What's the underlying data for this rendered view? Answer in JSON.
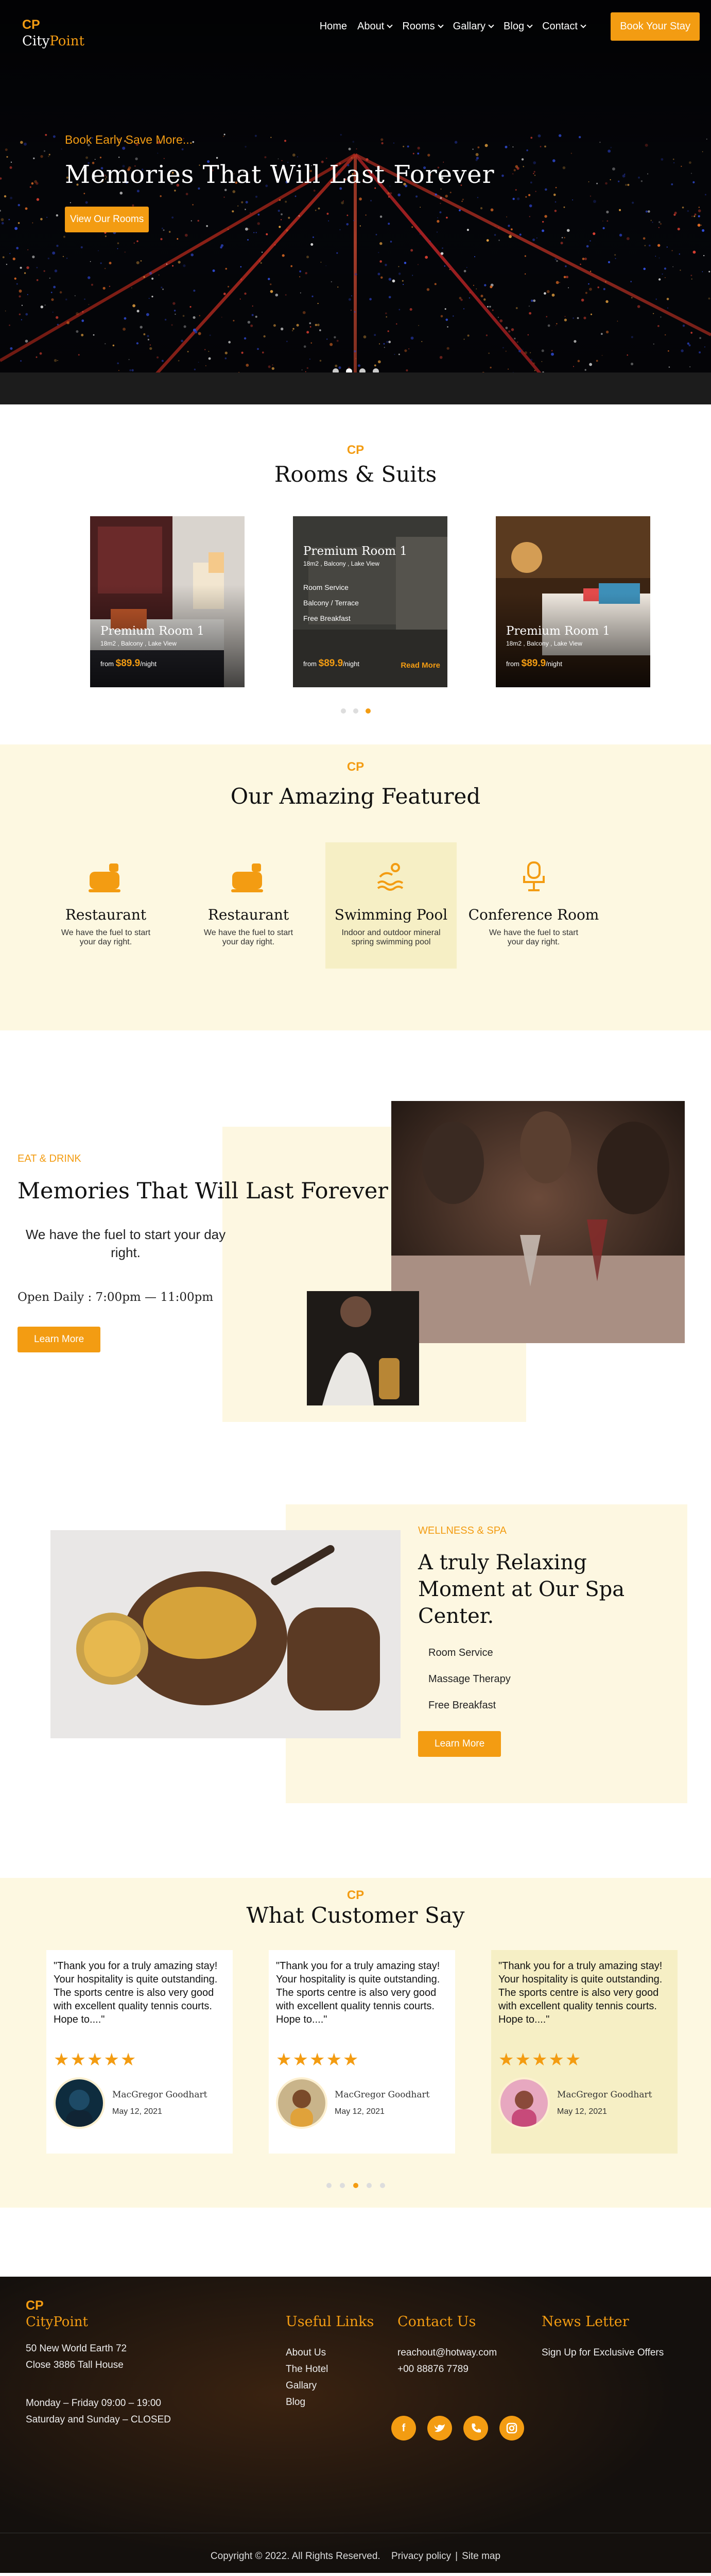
{
  "header": {
    "logo_cp": "CP",
    "logo_city": "City",
    "logo_point": "Point",
    "nav": [
      {
        "label": "Home",
        "dropdown": false
      },
      {
        "label": "About",
        "dropdown": true
      },
      {
        "label": "Rooms",
        "dropdown": true
      },
      {
        "label": "Gallary",
        "dropdown": true
      },
      {
        "label": "Blog",
        "dropdown": true
      },
      {
        "label": "Contact",
        "dropdown": true
      }
    ],
    "book_label": "Book Your Stay"
  },
  "hero": {
    "subtitle": "Book Early Save More...",
    "title": "Memories That Will Last Forever",
    "cta": "View Our Rooms",
    "slides": 4,
    "active_slide": 2
  },
  "rooms": {
    "cp": "CP",
    "title": "Rooms & Suits",
    "cards": [
      {
        "name": "Premium Room 1",
        "meta": "18m2 , Balcony , Lake View",
        "price_prefix": "from",
        "price": "$89.9",
        "price_suffix": "/night"
      },
      {
        "name": "Premium Room 1",
        "meta": "18m2 , Balcony , Lake View",
        "features": [
          "Room Service",
          "Balcony / Terrace",
          "Free Breakfast"
        ],
        "price_prefix": "from",
        "price": "$89.9",
        "price_suffix": "/night",
        "read_more": "Read More"
      },
      {
        "name": "Premium Room 1",
        "meta": "18m2 , Balcony , Lake View",
        "price_prefix": "from",
        "price": "$89.9",
        "price_suffix": "/night"
      }
    ],
    "slides": 3,
    "active_slide": 2
  },
  "featured": {
    "cp": "CP",
    "title": "Our Amazing Featured",
    "items": [
      {
        "icon": "kettle-icon",
        "title": "Restaurant",
        "desc": "We have the fuel to start your day right."
      },
      {
        "icon": "kettle-icon",
        "title": "Restaurant",
        "desc": "We have the fuel to start your day right."
      },
      {
        "icon": "swimming-icon",
        "title": "Swimming Pool",
        "desc": "Indoor and outdoor mineral spring swimming pool"
      },
      {
        "icon": "chair-icon",
        "title": "Conference Room",
        "desc": "We have the fuel to start your day right."
      }
    ]
  },
  "eat": {
    "tag": "EAT & DRINK",
    "title": "Memories That Will Last Forever",
    "desc": "We have the fuel to start your day right.",
    "open": "Open Daily : 7:00pm — 11:00pm",
    "cta": "Learn More"
  },
  "spa": {
    "tag": "WELLNESS & SPA",
    "title": "A truly Relaxing Moment at Our Spa Center.",
    "list": [
      "Room Service",
      "Massage Therapy",
      "Free Breakfast"
    ],
    "cta": "Learn More"
  },
  "testimonials": {
    "cp": "CP",
    "title": "What Customer Say",
    "items": [
      {
        "quote": "\"Thank you for a truly amazing stay! Your hospitality is quite outstanding. The sports centre is also very good with excellent quality tennis courts. Hope to....\"",
        "stars": "★★★★★",
        "name": "MacGregor Goodhart",
        "date": "May 12, 2021"
      },
      {
        "quote": "\"Thank you for a truly amazing stay! Your hospitality is quite outstanding. The sports centre is also very good with excellent quality tennis courts. Hope to....\"",
        "stars": "★★★★★",
        "name": "MacGregor Goodhart",
        "date": "May 12, 2021"
      },
      {
        "quote": "\"Thank you for a truly amazing stay! Your hospitality is quite outstanding. The sports centre is also very good with excellent quality tennis courts. Hope to....\"",
        "stars": "★★★★★",
        "name": "MacGregor Goodhart",
        "date": "May 12, 2021"
      }
    ],
    "slides": 5,
    "active_slide": 3
  },
  "footer": {
    "logo_cp": "CP",
    "logo_city": "City",
    "logo_point": "Point",
    "address1": "50 New World Earth 72",
    "address2": "Close 3886 Tall House",
    "hours1": "Monday – Friday 09:00 – 19:00",
    "hours2": "Saturday and Sunday – CLOSED",
    "links_title": "Useful Links",
    "links": [
      "About Us",
      "The Hotel",
      "Gallary",
      "Blog"
    ],
    "contact_title": "Contact Us",
    "email": "reachout@hotway.com",
    "phone": "+00 88876 7789",
    "news_title": "News Letter",
    "news_text": "Sign Up for Exclusive Offers",
    "social": [
      "facebook-icon",
      "twitter-icon",
      "phone-icon",
      "instagram-icon"
    ],
    "copyright": "Copyright © 2022. All Rights Reserved.",
    "privacy": "Privacy policy",
    "sitemap": "Site map"
  },
  "colors": {
    "accent": "#f39c12",
    "cream": "#fdf8e1",
    "dark": "#070709"
  }
}
